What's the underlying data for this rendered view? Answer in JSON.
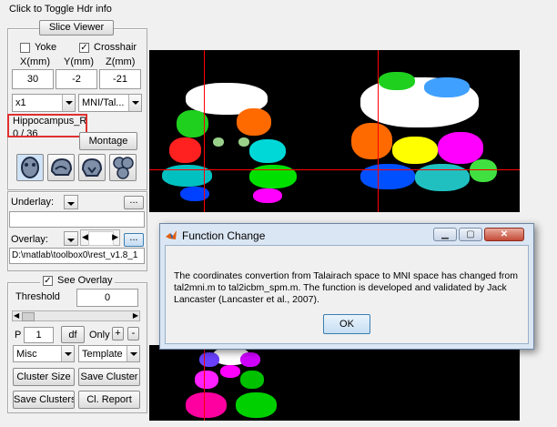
{
  "header": {
    "toggle_info": "Click to Toggle Hdr info"
  },
  "slice_viewer": {
    "title": "Slice Viewer"
  },
  "options": {
    "yoke_label": "Yoke",
    "crosshair_label": "Crosshair",
    "crosshair_checked": true
  },
  "coords": {
    "labels": [
      "X(mm)",
      "Y(mm)",
      "Z(mm)"
    ],
    "values": [
      "30",
      "-2",
      "-21"
    ]
  },
  "view": {
    "zoom_value": "x1",
    "template_value": "MNI/Tal..."
  },
  "region": {
    "name": "Hippocampus_R",
    "count": "0 / 36"
  },
  "montage_label": "Montage",
  "underlay": {
    "label": "Underlay:",
    "browse": "...",
    "value": ""
  },
  "overlay": {
    "label": "Overlay:",
    "browse": "...",
    "path": "D:\\matlab\\toolbox0\\rest_v1.8_1"
  },
  "see_overlay": {
    "label": "See Overlay",
    "checked": true
  },
  "threshold": {
    "label": "Threshold",
    "value": "0"
  },
  "p_value": {
    "label": "P",
    "value": "1"
  },
  "df_label": "df",
  "only_label": "Only",
  "plus_label": "+",
  "minus_label": "-",
  "misc_value": "Misc",
  "template_value": "Template",
  "buttons": {
    "cluster_size": "Cluster Size",
    "save_cluster": "Save Cluster",
    "save_clusters": "Save Clusters",
    "cl_report": "Cl. Report"
  },
  "dialog": {
    "title": "Function Change",
    "message": "The coordinates convertion from Talairach space to MNI space has changed from tal2mni.m to tal2icbm_spm.m. The function is developed and validated by Jack Lancaster (Lancaster et al., 2007).",
    "ok_label": "OK"
  },
  "colors": {
    "crosshair": "#ff0000",
    "highlight_box": "#e03030",
    "selected_icon_bg": "#cfe3f7"
  }
}
